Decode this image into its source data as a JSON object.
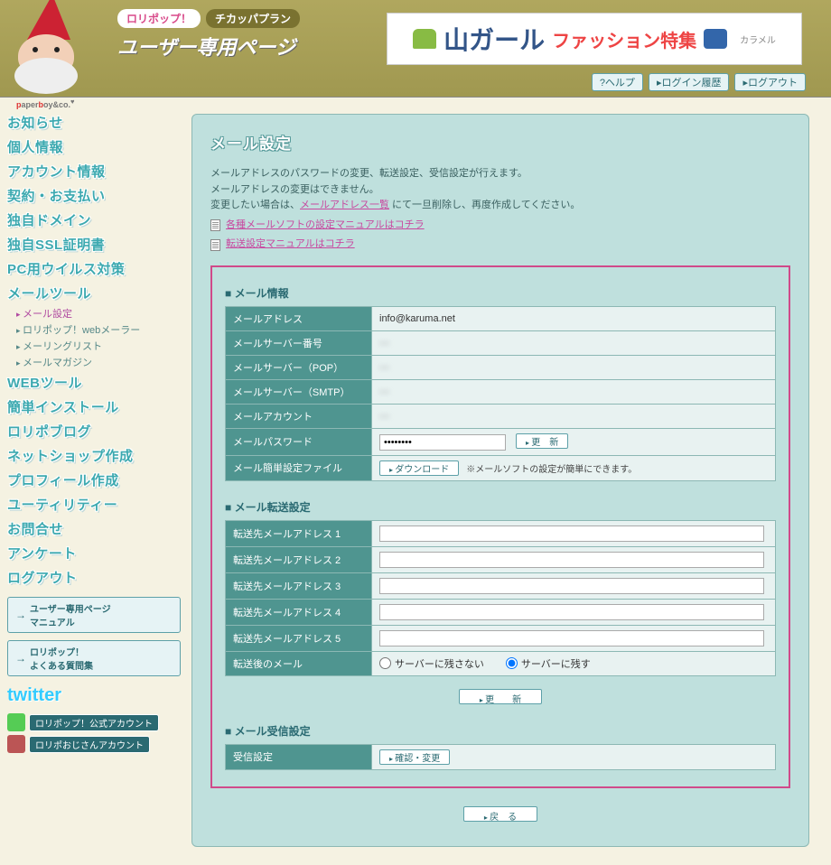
{
  "header": {
    "brand_top": "ロリポップ！",
    "brand_plan": "チカッパプラン",
    "brand_sub": "ユーザー専用ページ",
    "paperboy": "paperboy&co.",
    "banner": {
      "big": "山ガール",
      "mid": "ファッション特集",
      "brand": "カラメル"
    },
    "buttons": {
      "help": "?ヘルプ",
      "history": "▸ログイン履歴",
      "logout": "▸ログアウト"
    }
  },
  "sidebar": {
    "items": [
      "お知らせ",
      "個人情報",
      "アカウント情報",
      "契約・お支払い",
      "独自ドメイン",
      "独自SSL証明書",
      "PC用ウイルス対策",
      "メールツール"
    ],
    "sub_mail": [
      "メール設定",
      "ロリポップ！webメーラー",
      "メーリングリスト",
      "メールマガジン"
    ],
    "items2": [
      "WEBツール",
      "簡単インストール",
      "ロリポブログ",
      "ネットショップ作成",
      "プロフィール作成",
      "ユーティリティー",
      "お問合せ",
      "アンケート",
      "ログアウト"
    ],
    "box1a": "ユーザー専用ページ",
    "box1b": "マニュアル",
    "box2a": "ロリポップ！",
    "box2b": "よくある質問集",
    "twitter": "twitter",
    "tw1": "ロリポップ！公式アカウント",
    "tw2": "ロリポおじさんアカウント"
  },
  "page": {
    "title": "メール設定",
    "desc1": "メールアドレスのパスワードの変更、転送設定、受信設定が行えます。",
    "desc2": "メールアドレスの変更はできません。",
    "desc3a": "変更したい場合は、",
    "desc3_link": "メールアドレス一覧",
    "desc3b": " にて一旦削除し、再度作成してください。",
    "manual1": "各種メールソフトの設定マニュアルはコチラ",
    "manual2": "転送設定マニュアルはコチラ"
  },
  "mail_info": {
    "title": "メール情報",
    "labels": {
      "addr": "メールアドレス",
      "num": "メールサーバー番号",
      "pop": "メールサーバー（POP）",
      "smtp": "メールサーバー（SMTP）",
      "acct": "メールアカウント",
      "pass": "メールパスワード",
      "file": "メール簡単設定ファイル"
    },
    "addr": "info@karuma.net",
    "num": "—",
    "pop": "—",
    "smtp": "—",
    "acct": "—",
    "pass": "••••••••",
    "btn_update": "更　新",
    "btn_download": "ダウンロード",
    "file_note": "※メールソフトの設定が簡単にできます。"
  },
  "forward": {
    "title": "メール転送設定",
    "rows": [
      "転送先メールアドレス 1",
      "転送先メールアドレス 2",
      "転送先メールアドレス 3",
      "転送先メールアドレス 4",
      "転送先メールアドレス 5"
    ],
    "after_label": "転送後のメール",
    "opt_off": "サーバーに残さない",
    "opt_on": "サーバーに残す",
    "btn_update": "更　　新"
  },
  "receive": {
    "title": "メール受信設定",
    "label": "受信設定",
    "btn": "確認・変更"
  },
  "back_btn": "戻　る"
}
